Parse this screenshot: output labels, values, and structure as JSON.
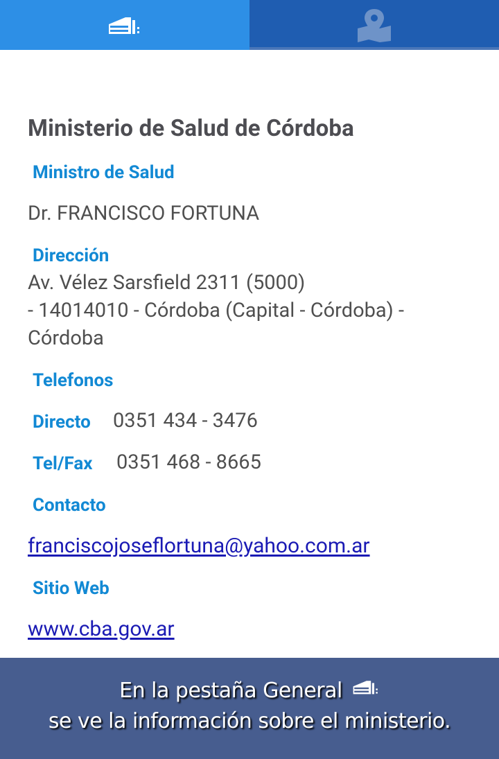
{
  "tabs": [
    {
      "name": "General",
      "icon": "building-icon",
      "active": true
    },
    {
      "name": "Mapa",
      "icon": "map-pin-icon",
      "active": false
    }
  ],
  "ministry": {
    "title": "Ministerio de Salud de Córdoba",
    "minister_label": "Ministro de Salud",
    "minister_name": "Dr. FRANCISCO FORTUNA",
    "address_label": "Dirección",
    "address_line1": "Av. Vélez Sarsfield 2311 (5000)",
    "address_line2": "- 14014010 - Córdoba (Capital - Córdoba) -",
    "address_line3": "Córdoba",
    "phones_label": "Telefonos",
    "direct_label": "Directo",
    "direct_value": "0351 434 - 3476",
    "telfax_label": "Tel/Fax",
    "telfax_value": "0351 468 - 8665",
    "contact_label": "Contacto",
    "contact_email": "franciscojoseflortuna@yahoo.com.ar",
    "website_label": "Sitio Web",
    "website_url": "www.cba.gov.ar"
  },
  "footer": {
    "line1": "En la pestaña General",
    "line2": "se ve la información sobre el ministerio."
  },
  "colors": {
    "tab_active": "#2d8fe6",
    "tab_inactive": "#1f5db1",
    "label": "#1289d4",
    "footer_bg": "#475d8f"
  }
}
